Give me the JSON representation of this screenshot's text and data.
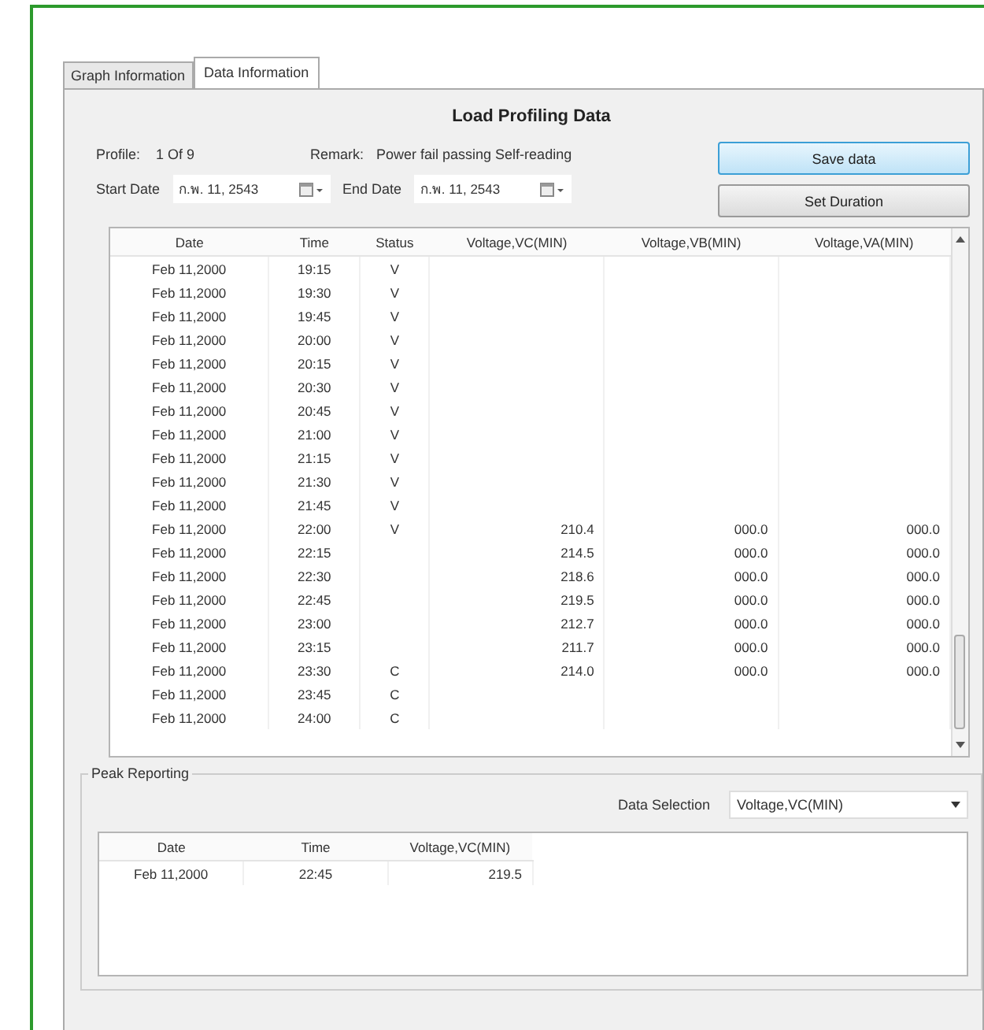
{
  "tabs": [
    {
      "label": "Graph Information",
      "selected": false
    },
    {
      "label": "Data Information",
      "selected": true
    }
  ],
  "title": "Load Profiling Data",
  "profile": {
    "label": "Profile:",
    "value": "1 Of 9"
  },
  "remark": {
    "label": "Remark:",
    "value": "Power fail passing Self-reading"
  },
  "start_date": {
    "label": "Start Date",
    "value": "ก.พ. 11, 2543"
  },
  "end_date": {
    "label": "End Date",
    "value": "ก.พ. 11, 2543"
  },
  "buttons": [
    {
      "label": "Save data",
      "selected": true
    },
    {
      "label": "Set Duration",
      "selected": false
    }
  ],
  "table": {
    "columns": [
      "Date",
      "Time",
      "Status",
      "Voltage,VC(MIN)",
      "Voltage,VB(MIN)",
      "Voltage,VA(MIN)"
    ],
    "rows": [
      [
        "Feb 11,2000",
        "19:15",
        "V",
        "",
        "",
        ""
      ],
      [
        "Feb 11,2000",
        "19:30",
        "V",
        "",
        "",
        ""
      ],
      [
        "Feb 11,2000",
        "19:45",
        "V",
        "",
        "",
        ""
      ],
      [
        "Feb 11,2000",
        "20:00",
        "V",
        "",
        "",
        ""
      ],
      [
        "Feb 11,2000",
        "20:15",
        "V",
        "",
        "",
        ""
      ],
      [
        "Feb 11,2000",
        "20:30",
        "V",
        "",
        "",
        ""
      ],
      [
        "Feb 11,2000",
        "20:45",
        "V",
        "",
        "",
        ""
      ],
      [
        "Feb 11,2000",
        "21:00",
        "V",
        "",
        "",
        ""
      ],
      [
        "Feb 11,2000",
        "21:15",
        "V",
        "",
        "",
        ""
      ],
      [
        "Feb 11,2000",
        "21:30",
        "V",
        "",
        "",
        ""
      ],
      [
        "Feb 11,2000",
        "21:45",
        "V",
        "",
        "",
        ""
      ],
      [
        "Feb 11,2000",
        "22:00",
        "V",
        "210.4",
        "000.0",
        "000.0"
      ],
      [
        "Feb 11,2000",
        "22:15",
        "",
        "214.5",
        "000.0",
        "000.0"
      ],
      [
        "Feb 11,2000",
        "22:30",
        "",
        "218.6",
        "000.0",
        "000.0"
      ],
      [
        "Feb 11,2000",
        "22:45",
        "",
        "219.5",
        "000.0",
        "000.0"
      ],
      [
        "Feb 11,2000",
        "23:00",
        "",
        "212.7",
        "000.0",
        "000.0"
      ],
      [
        "Feb 11,2000",
        "23:15",
        "",
        "211.7",
        "000.0",
        "000.0"
      ],
      [
        "Feb 11,2000",
        "23:30",
        "C",
        "214.0",
        "000.0",
        "000.0"
      ],
      [
        "Feb 11,2000",
        "23:45",
        "C",
        "",
        "",
        ""
      ],
      [
        "Feb 11,2000",
        "24:00",
        "C",
        "",
        "",
        ""
      ]
    ]
  },
  "peak": {
    "title": "Peak Reporting",
    "selection_label": "Data Selection",
    "selection_value": "Voltage,VC(MIN)",
    "columns": [
      "Date",
      "Time",
      "Voltage,VC(MIN)"
    ],
    "rows": [
      [
        "Feb 11,2000",
        "22:45",
        "219.5"
      ]
    ]
  }
}
